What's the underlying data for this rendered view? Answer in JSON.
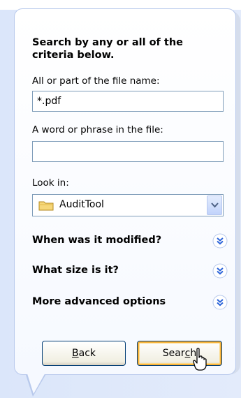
{
  "prompt": "Search by any or all of the criteria below.",
  "fields": {
    "filename_label": "All or part of the file name:",
    "filename_value": "*.pdf",
    "phrase_label": "A word or phrase in the file:",
    "phrase_value": ""
  },
  "look_in": {
    "label": "Look in:",
    "value": "AuditTool",
    "icon": "folder-icon"
  },
  "sections": [
    {
      "label": "When was it modified?"
    },
    {
      "label": "What size is it?"
    },
    {
      "label": "More advanced options"
    }
  ],
  "buttons": {
    "back_accel": "B",
    "back_rest": "ack",
    "search_pre": "Sear",
    "search_accel": "c",
    "search_post": "h"
  },
  "colors": {
    "panel_border": "#b8c9ec",
    "accent_blue": "#2b63d9",
    "focus_orange": "#f8b33a"
  }
}
